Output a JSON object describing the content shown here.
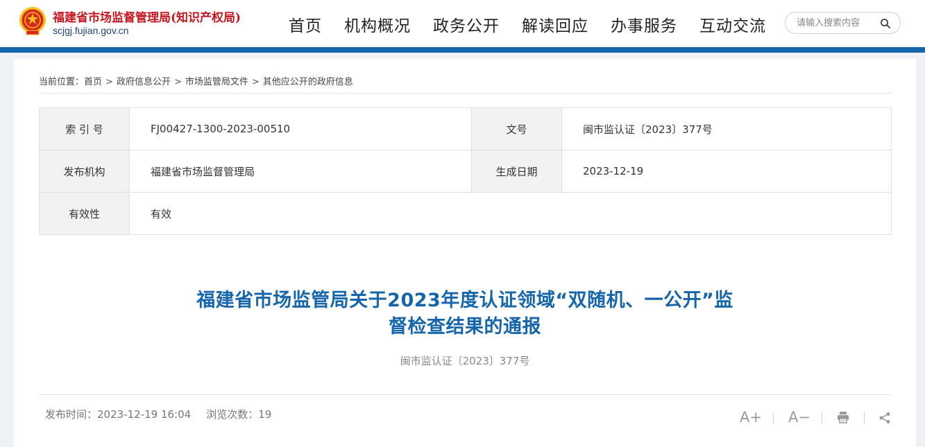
{
  "header": {
    "site_name": "福建省市场监督管理局(知识产权局)",
    "domain": "scjgj.fujian.gov.cn",
    "nav": [
      {
        "label": "首页"
      },
      {
        "label": "机构概况"
      },
      {
        "label": "政务公开"
      },
      {
        "label": "解读回应"
      },
      {
        "label": "办事服务"
      },
      {
        "label": "互动交流"
      }
    ],
    "search": {
      "placeholder": "请输入搜索内容",
      "value": ""
    }
  },
  "breadcrumb": {
    "prefix": "当前位置：",
    "items": [
      "首页",
      "政府信息公开",
      "市场监管局文件",
      "其他应公开的政府信息"
    ],
    "separator": ">"
  },
  "meta": {
    "index_label": "索 引 号",
    "index_value": "FJ00427-1300-2023-00510",
    "docno_label": "文号",
    "docno_value": "闽市监认证〔2023〕377号",
    "publisher_label": "发布机构",
    "publisher_value": "福建省市场监督管理局",
    "date_label": "生成日期",
    "date_value": "2023-12-19",
    "validity_label": "有效性",
    "validity_value": "有效"
  },
  "article": {
    "title_line1": "福建省市场监管局关于2023年度认证领域“双随机、一公开”监",
    "title_line2": "督检查结果的通报",
    "doc_number": "闽市监认证〔2023〕377号",
    "publish_label": "发布时间：",
    "publish_time": "2023-12-19 16:04",
    "views_label": "浏览次数：",
    "views": "19"
  },
  "tools": {
    "font_increase": "A+",
    "font_decrease": "A−",
    "print_icon": "print-icon",
    "share_icon": "share-icon"
  },
  "colors": {
    "brand_red": "#c8161e",
    "accent_blue": "#1565ad",
    "page_bg": "#eef2f7"
  }
}
